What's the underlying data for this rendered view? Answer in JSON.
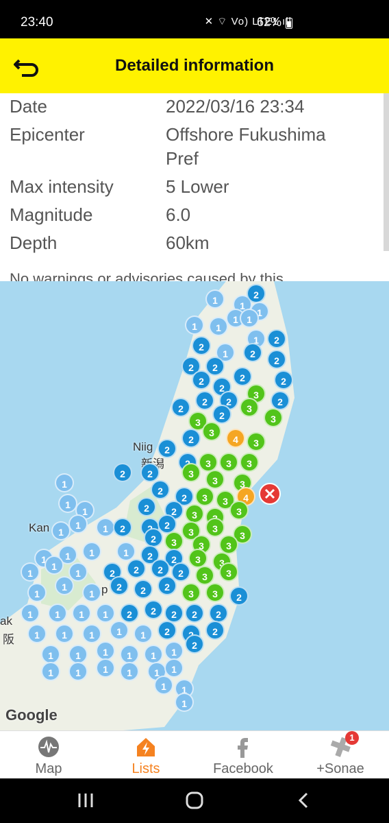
{
  "status_bar": {
    "time": "23:40",
    "icons": "✕ ⌔ Vo) LTE1 ıll",
    "battery": "62%"
  },
  "header": {
    "title": "Detailed information",
    "back_icon": "back-arrow-icon",
    "background": "#fff200"
  },
  "details": {
    "rows": [
      {
        "label": "Date",
        "value": "2022/03/16 23:34"
      },
      {
        "label": "Epicenter",
        "value_line1": "Offshore Fukushima",
        "value_line2": "Pref"
      },
      {
        "label": "Max intensity",
        "value": "5 Lower"
      },
      {
        "label": "Magnitude",
        "value": "6.0"
      },
      {
        "label": "Depth",
        "value": "60km"
      }
    ],
    "note": "No warnings or advisories caused by this"
  },
  "map": {
    "places": [
      "Niig",
      "新潟",
      "Kan",
      "Jap",
      "ak",
      "阪"
    ],
    "attribution": "Google",
    "epicenter_icon": "epicenter-x-icon",
    "intensity_colors": {
      "1": "#7fbfee",
      "2": "#1a8fd6",
      "3": "#52c41a",
      "4": "#f5a623"
    },
    "intensities": [
      "1",
      "1",
      "1",
      "2",
      "2",
      "2",
      "3",
      "3",
      "4"
    ]
  },
  "bottom_nav": {
    "items": [
      {
        "label": "Map",
        "icon": "seismograph-icon"
      },
      {
        "label": "Lists",
        "icon": "lightning-house-icon"
      },
      {
        "label": "Facebook",
        "icon": "facebook-f-icon"
      },
      {
        "label": "+Sonae",
        "icon": "plus-cross-icon"
      }
    ],
    "badge": "1",
    "accent": "#f58220"
  },
  "system_nav": {
    "icons": [
      "recent-apps-icon",
      "home-icon",
      "back-icon"
    ]
  }
}
